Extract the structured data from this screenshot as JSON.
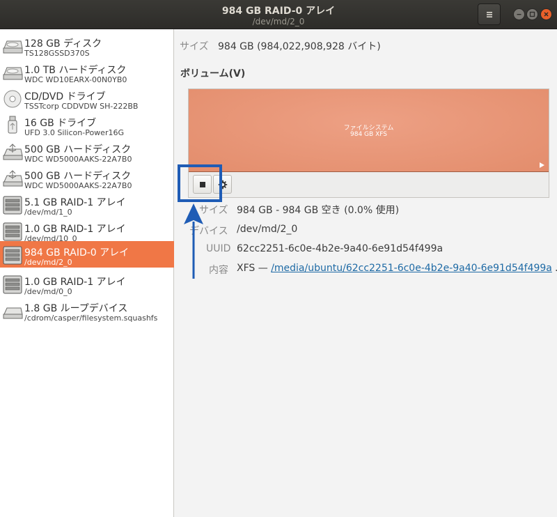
{
  "window": {
    "title": "984 GB RAID-0 アレイ",
    "subtitle": "/dev/md/2_0"
  },
  "sidebar": {
    "items": [
      {
        "name": "128 GB ディスク",
        "sub": "TS128GSSD370S",
        "icon": "ssd-disk-icon"
      },
      {
        "name": "1.0 TB ハードディスク",
        "sub": "WDC WD10EARX-00N0YB0",
        "icon": "hard-disk-icon"
      },
      {
        "name": "CD/DVD ドライブ",
        "sub": "TSSTcorp CDDVDW SH-222BB",
        "icon": "optical-disc-icon"
      },
      {
        "name": "16 GB ドライブ",
        "sub": "UFD 3.0 Silicon-Power16G",
        "icon": "usb-drive-icon"
      },
      {
        "name": "500 GB ハードディスク",
        "sub": "WDC WD5000AAKS-22A7B0",
        "icon": "usb-hard-disk-icon"
      },
      {
        "name": "500 GB ハードディスク",
        "sub": "WDC WD5000AAKS-22A7B0",
        "icon": "usb-hard-disk-icon"
      },
      {
        "name": "5.1 GB RAID-1 アレイ",
        "sub": "/dev/md/1_0",
        "icon": "raid-array-icon"
      },
      {
        "name": "1.0 GB RAID-1 アレイ",
        "sub": "/dev/md/10_0",
        "icon": "raid-array-icon"
      },
      {
        "name": "984 GB RAID-0 アレイ",
        "sub": "/dev/md/2_0",
        "icon": "raid-array-icon",
        "selected": true
      },
      {
        "name": "1.0 GB RAID-1 アレイ",
        "sub": "/dev/md/0_0",
        "icon": "raid-array-icon"
      },
      {
        "name": "1.8 GB ループデバイス",
        "sub": "/cdrom/casper/filesystem.squashfs",
        "icon": "loop-device-icon"
      }
    ]
  },
  "main": {
    "size_label": "サイズ",
    "size_value": "984 GB (984,022,908,928 バイト)",
    "volumes_heading": "ボリューム(V)",
    "partition": {
      "type": "ファイルシステム",
      "size": "984 GB XFS"
    },
    "details": [
      {
        "label": "サイズ",
        "value": "984 GB - 984 GB 空き (0.0% 使用)"
      },
      {
        "label": "デバイス",
        "value": "/dev/md/2_0"
      },
      {
        "label": "UUID",
        "value": "62cc2251-6c0e-4b2e-9a40-6e91d54f499a"
      },
      {
        "label": "内容",
        "value_prefix": "XFS — ",
        "value_link": "/media/ubuntu/62cc2251-6c0e-4b2e-9a40-6e91d54f499a",
        "ellipsis": "…"
      }
    ]
  },
  "colors": {
    "selection": "#f07746",
    "partition": "#e8967a",
    "annotation": "#1f5cb5"
  }
}
